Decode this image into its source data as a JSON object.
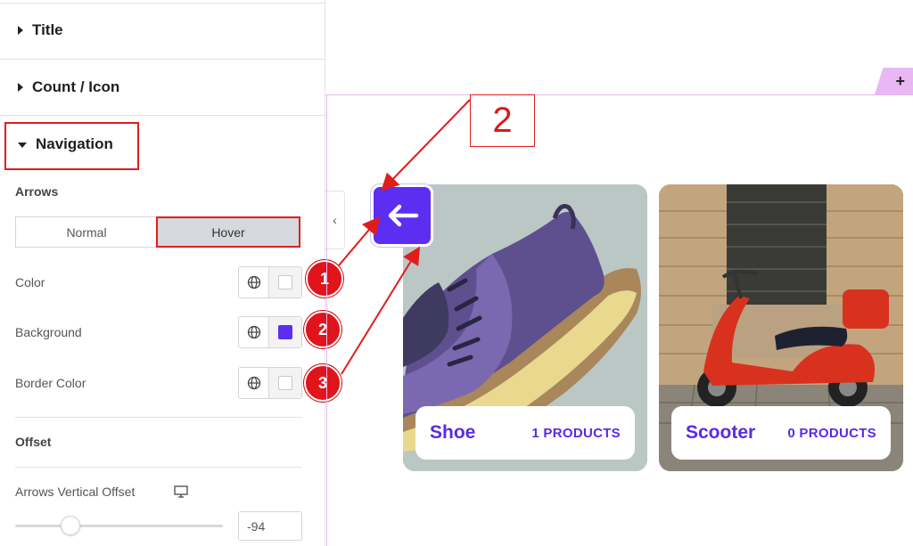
{
  "panel": {
    "sections": {
      "title": "Title",
      "count_icon": "Count / Icon",
      "navigation": "Navigation"
    },
    "arrows_heading": "Arrows",
    "tabs": {
      "normal": "Normal",
      "hover": "Hover",
      "active": "Hover"
    },
    "controls": [
      {
        "label": "Color",
        "swatch": "#ffffff"
      },
      {
        "label": "Background",
        "swatch": "#5b2ef2"
      },
      {
        "label": "Border Color",
        "swatch": "#ffffff"
      }
    ],
    "offset_heading": "Offset",
    "vertical_offset": {
      "label": "Arrows Vertical Offset",
      "value": "-94",
      "device_icon": "desktop-icon"
    }
  },
  "annotations": {
    "callout_number": "2",
    "badges": [
      "1",
      "2",
      "3"
    ],
    "color": "#e01d1d"
  },
  "canvas": {
    "add_section": "+",
    "prev_arrow_icon": "arrow-left-icon",
    "accent": "#5b2ef2",
    "cards": [
      {
        "name": "Shoe",
        "count": "1 PRODUCTS"
      },
      {
        "name": "Scooter",
        "count": "0 PRODUCTS"
      }
    ]
  }
}
